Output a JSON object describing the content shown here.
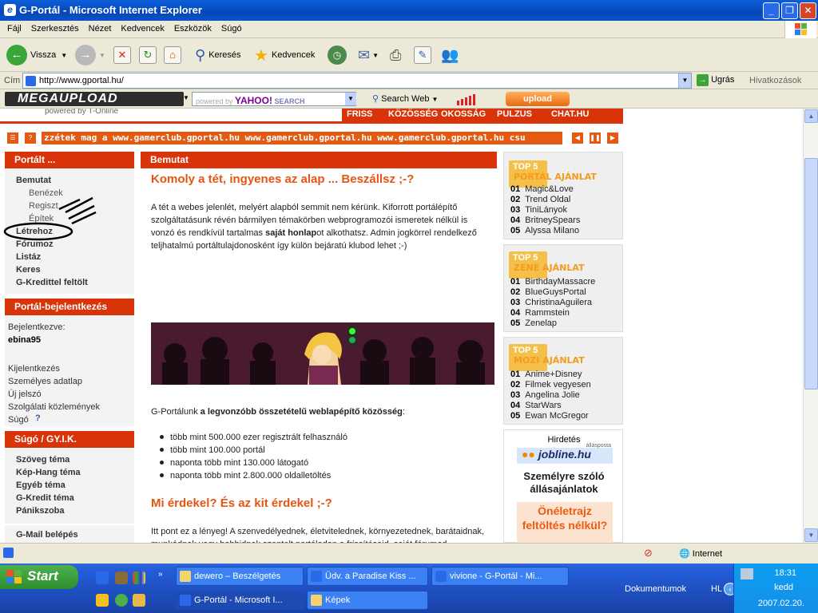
{
  "window": {
    "title": "G-Portál - Microsoft Internet Explorer"
  },
  "menu": [
    "Fájl",
    "Szerkesztés",
    "Nézet",
    "Kedvencek",
    "Eszközök",
    "Súgó"
  ],
  "toolbar": {
    "back": "Vissza",
    "search": "Keresés",
    "favorites": "Kedvencek"
  },
  "address": {
    "label": "Cím",
    "url": "http://www.gportal.hu/",
    "go": "Ugrás",
    "links": "Hivatkozások"
  },
  "yahoo_bar": {
    "mega": "MEGAUPLOAD",
    "powered": "powered by",
    "yahoo": "YAHOO!",
    "search_word": "SEARCH",
    "search_web": "Search Web",
    "upload": "upload"
  },
  "page": {
    "tonline": "powered by T-Online",
    "nav": [
      "FRISS",
      "KÖZÖSSÉG",
      "OKOSSÁG",
      "PULZUS",
      "CHAT.HU"
    ],
    "ticker": "zzétek mag a www.gamerclub.gportal.hu www.gamerclub.gportal.hu www.gamerclub.gportal.hu csu",
    "portal_box": {
      "title": "Portált ...",
      "bemutat": "Bemutat",
      "benezek": "Benézek",
      "regiszt": "Regiszt",
      "epitek": "Építek",
      "letrehoz": "Létrehoz",
      "forumoz": "Fórumoz",
      "listaz": "Listáz",
      "keres": "Keres",
      "gkredit": "G-Kredittel feltölt"
    },
    "login_box": {
      "title": "Portál-bejelentkezés",
      "logged_in": "Bejelentkezve:",
      "user": "ebina95",
      "logout": "Kijelentkezés",
      "personal": "Személyes adatlap",
      "newpass": "Új jelszó",
      "service": "Szolgálati közlemények",
      "help": "Súgó"
    },
    "help_box": {
      "title": "Súgó / GY.I.K.",
      "items": [
        "Szöveg téma",
        "Kép-Hang téma",
        "Egyéb téma",
        "G-Kredit téma",
        "Pánikszoba"
      ],
      "gmail": "G-Mail belépés"
    },
    "main": {
      "tab": "Bemutat",
      "h1": "Komoly a tét, ingyenes az alap ... Beszállsz ;-?",
      "p1a": "A tét a webes jelenlét, melyért alapból semmit nem kérünk. Kiforrott portálépítő szolgáltatásunk révén bármilyen témakörben webprogramozói ismeretek nélkül is vonzó és rendkívül tartalmas ",
      "p1b": "saját honlap",
      "p1c": "ot alkothatsz. Admin jogkörrel rendelkező teljhatalmú portáltulajdonosként így külön bejáratú klubod lehet ;-)",
      "p2a": "G-Portálunk ",
      "p2b": "a legvonzóbb összetételű weblapépítő közösség",
      "p2c": ":",
      "bullets": [
        "több mint 500.000 ezer regisztrált felhasználó",
        "több mint 100.000 portál",
        "naponta több mint 130.000 látogató",
        "naponta több mint 2.800.000 oldalletöltés"
      ],
      "h2": "Mi érdekel? És az kit érdekel ;-?",
      "p3": "Itt pont ez a lényeg! A szenvedélyednek, életvitelednek, környezetednek, barátaidnak, munkádnak vagy hobbidnak szentelt portálodon a frissítéseid, saját fórumod, (mozgó)képeid, vagy a népszerűsíteni kívánt szolgáltatásaid vonzó tálalása révén közösségformáló erőként lehetsz jelen a hasonló érdeklődésűek"
    },
    "top5_portal": {
      "badge": "TOP 5",
      "label": "PORTÁL AJÁNLAT",
      "items": [
        [
          "01",
          "Magic&Love"
        ],
        [
          "02",
          "Trend Oldal"
        ],
        [
          "03",
          "TiniLányok"
        ],
        [
          "04",
          "BritneySpears"
        ],
        [
          "05",
          "Alyssa Milano"
        ]
      ]
    },
    "top5_zene": {
      "badge": "TOP 5",
      "label": "ZENE AJÁNLAT",
      "items": [
        [
          "01",
          "BirthdayMassacre"
        ],
        [
          "02",
          "BlueGuysPortal"
        ],
        [
          "03",
          "ChristinaAguilera"
        ],
        [
          "04",
          "Rammstein"
        ],
        [
          "05",
          "Zenelap"
        ]
      ]
    },
    "top5_mozi": {
      "badge": "TOP 5",
      "label": "MOZI AJÁNLAT",
      "items": [
        [
          "01",
          "Anime+Disney"
        ],
        [
          "02",
          "Filmek vegyesen"
        ],
        [
          "03",
          "Angelina Jolie"
        ],
        [
          "04",
          "StarWars"
        ],
        [
          "05",
          "Ewan McGregor"
        ]
      ]
    },
    "ad": {
      "label": "Hirdetés",
      "brand": "jobline.hu",
      "brand_sub": "állásposta",
      "line1": "Személyre szóló állásajánlatok",
      "line2": "Önéletrajz feltöltés nélkül?"
    }
  },
  "status": {
    "zone": "Internet"
  },
  "taskbar": {
    "start": "Start",
    "tasks": [
      "dewero – Beszélgetés",
      "Üdv. a Paradise Kiss ...",
      "vivione - G-Portál - Mi...",
      "G-Portál - Microsoft I...",
      "Képek"
    ],
    "docs": "Dokumentumok",
    "lang": "HL",
    "time": "18:31",
    "day": "kedd",
    "date": "2007.02.20."
  }
}
